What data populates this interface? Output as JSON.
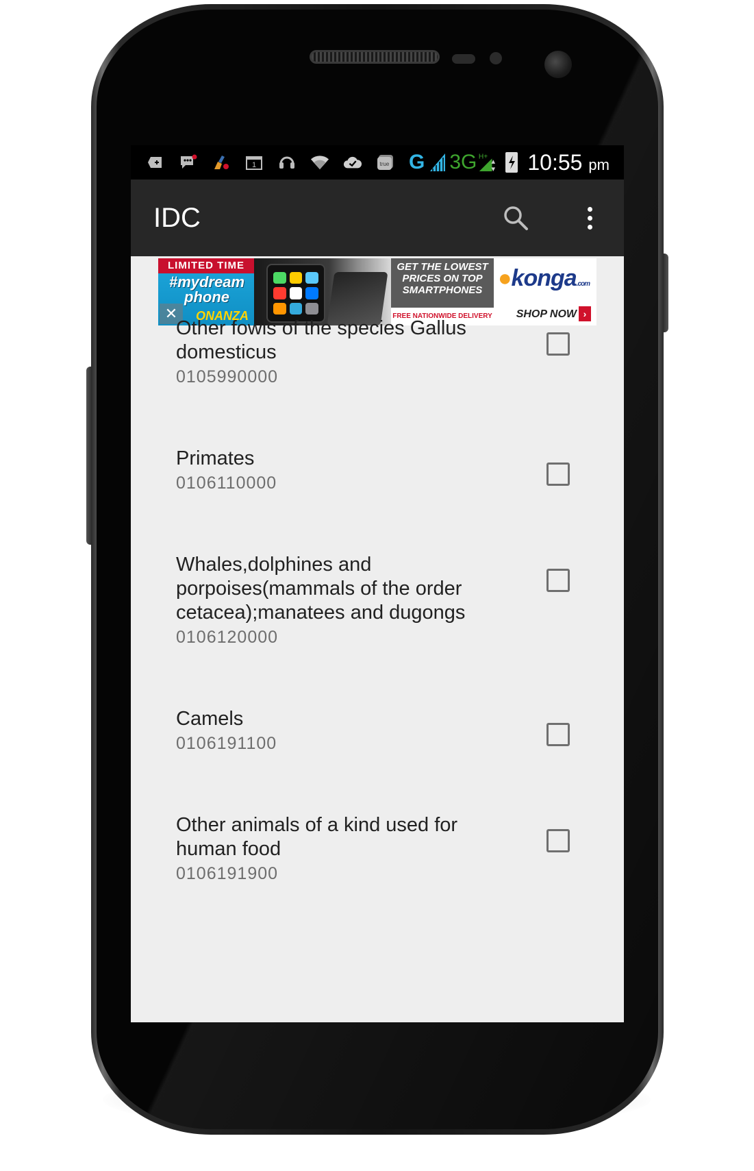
{
  "status_bar": {
    "icons": [
      "plus-icon",
      "chat-icon",
      "broom-icon",
      "calendar-icon",
      "headset-icon",
      "wifi-icon",
      "cloud-check-icon",
      "true-app-icon"
    ],
    "calendar_number": "1",
    "true_label": "true",
    "network_g": "G",
    "network_3g": "3G",
    "network_hplus": "H+",
    "time": "10:55",
    "time_suffix": "pm"
  },
  "app_bar": {
    "title": "IDC",
    "search_icon": "search-icon",
    "overflow_icon": "more-vert-icon"
  },
  "ad": {
    "limited_time": "LIMITED TIME",
    "hashtag": "#mydream phone",
    "bonanza": "ONANZA",
    "close_symbol": "✕",
    "lowest_prices": "GET THE LOWEST PRICES ON TOP SMARTPHONES",
    "free_delivery": "FREE NATIONWIDE DELIVERY",
    "brand": "konga",
    "brand_suffix": ".com",
    "shop_now": "SHOP NOW",
    "shop_arrow": "›"
  },
  "items": [
    {
      "title": "Other fowls of the species Gallus domesticus",
      "code": "0105990000",
      "checked": false
    },
    {
      "title": "Primates",
      "code": "0106110000",
      "checked": false
    },
    {
      "title": "Whales,dolphines and porpoises(mammals of the order cetacea);manatees and dugongs",
      "code": "0106120000",
      "checked": false
    },
    {
      "title": "Camels",
      "code": "0106191100",
      "checked": false
    },
    {
      "title": "Other animals of a kind used for human food",
      "code": "0106191900",
      "checked": false
    }
  ],
  "colors": {
    "app_bar": "#272727",
    "status_bar": "#000000",
    "list_background": "#eeeeee",
    "network_g": "#33b5e5",
    "network_3g": "#3ea52e"
  }
}
